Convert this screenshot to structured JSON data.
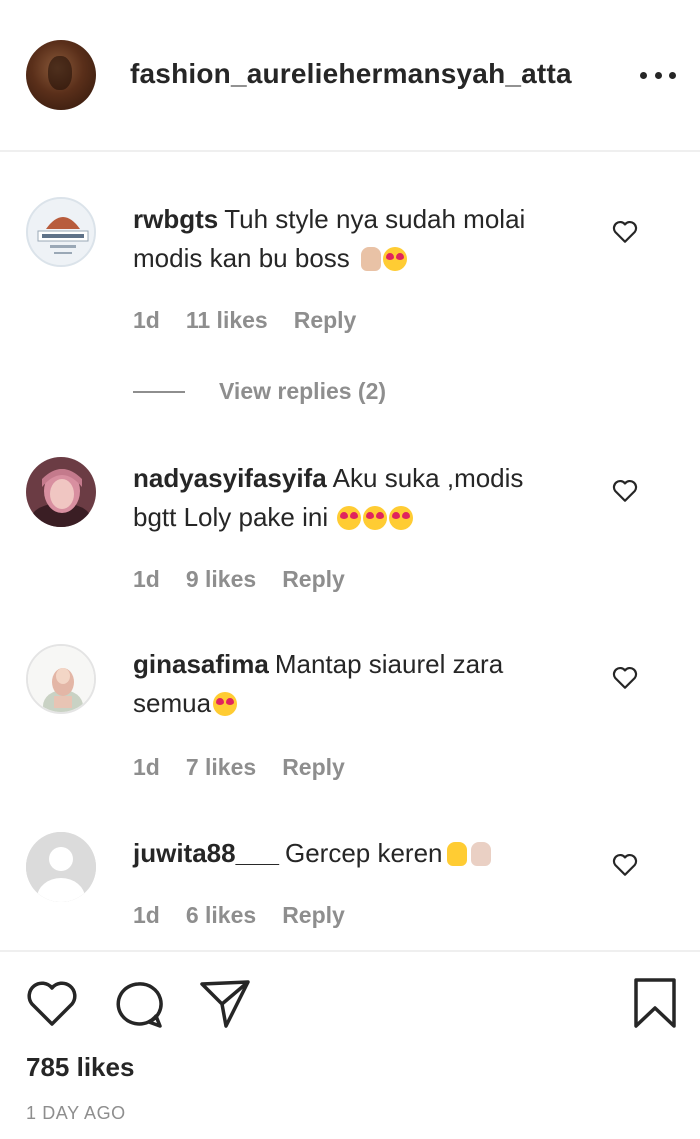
{
  "header": {
    "username": "fashion_aureliehermansyah_atta",
    "avatar_icon": "profile-avatar",
    "more_icon": "more-options-icon"
  },
  "comments": [
    {
      "username": "rwbgts",
      "text": "Tuh style nya sudah molai modis kan bu boss",
      "time": "1d",
      "likes": "11 likes",
      "reply": "Reply",
      "view_replies": "View replies (2)"
    },
    {
      "username": "nadyasyifasyifa",
      "text": "Aku suka ,modis bgtt Loly pake ini",
      "time": "1d",
      "likes": "9 likes",
      "reply": "Reply"
    },
    {
      "username": "ginasafima",
      "text": "Mantap siaurel zara semua",
      "time": "1d",
      "likes": "7 likes",
      "reply": "Reply"
    },
    {
      "username": "juwita88___",
      "text": "Gercep keren",
      "time": "1d",
      "likes": "6 likes",
      "reply": "Reply"
    }
  ],
  "footer": {
    "likes": "785 likes",
    "time_ago": "1 DAY AGO"
  },
  "colors": {
    "text": "#262626",
    "muted": "#8e8e8e",
    "divider": "#efefef"
  }
}
